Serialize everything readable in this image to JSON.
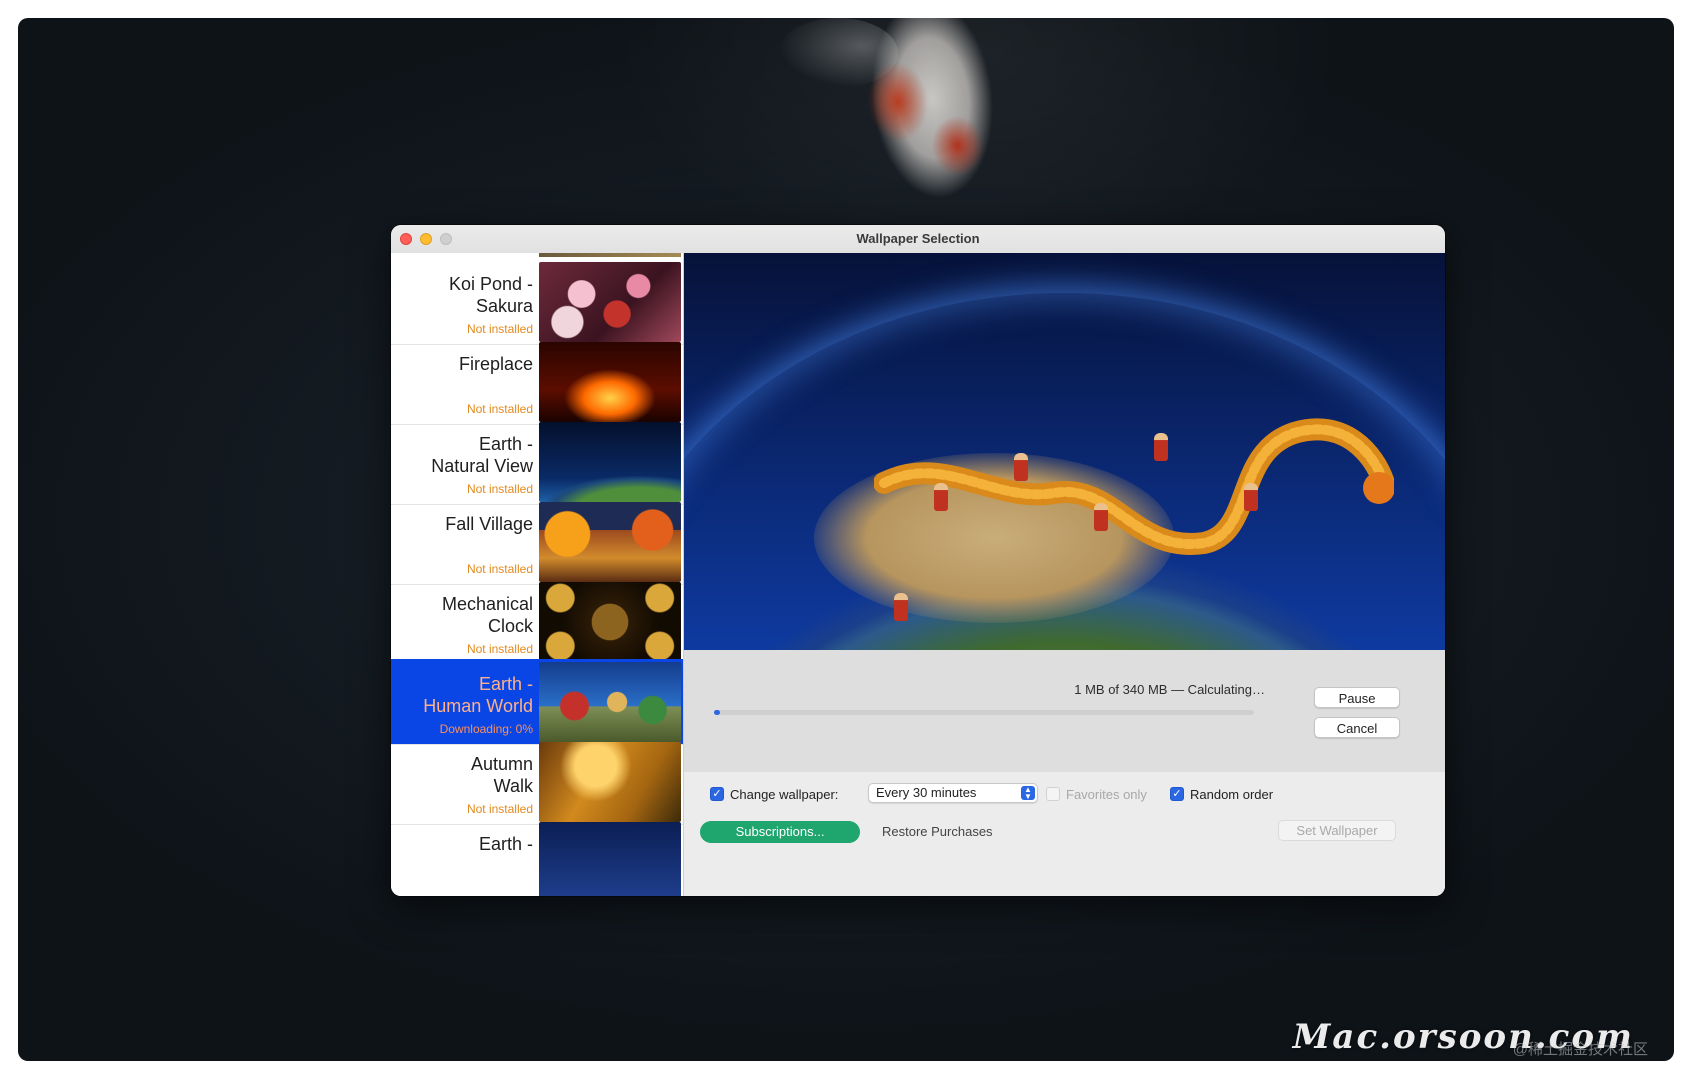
{
  "window": {
    "title": "Wallpaper Selection"
  },
  "wallpapers": [
    {
      "name": "Koi Pond -\nSakura",
      "status": "Not installed",
      "thumb": "koi-sakura"
    },
    {
      "name": "Fireplace",
      "status": "Not installed",
      "thumb": "fireplace"
    },
    {
      "name": "Earth -\nNatural View",
      "status": "Not installed",
      "thumb": "earth-natural"
    },
    {
      "name": "Fall Village",
      "status": "Not installed",
      "thumb": "fall-village"
    },
    {
      "name": "Mechanical\nClock",
      "status": "Not installed",
      "thumb": "mechanical-clock"
    },
    {
      "name": "Earth -\nHuman World",
      "status": "Downloading: 0%",
      "thumb": "earth-human",
      "selected": true
    },
    {
      "name": "Autumn\nWalk",
      "status": "Not installed",
      "thumb": "autumn-walk"
    },
    {
      "name": "Earth -",
      "status": "",
      "thumb": "earth-partial"
    }
  ],
  "download": {
    "progress_text": "1 MB of 340 MB — Calculating…",
    "progress_fraction": 0.003,
    "pause_label": "Pause",
    "cancel_label": "Cancel"
  },
  "options": {
    "change_wallpaper": {
      "label": "Change wallpaper:",
      "checked": true
    },
    "interval": {
      "selected": "Every 30 minutes"
    },
    "favorites_only": {
      "label": "Favorites only",
      "checked": false,
      "disabled": true
    },
    "random_order": {
      "label": "Random order",
      "checked": true
    }
  },
  "footer": {
    "subscriptions_label": "Subscriptions...",
    "restore_label": "Restore Purchases",
    "set_wallpaper_label": "Set Wallpaper"
  },
  "watermark": {
    "text": "Mac.orsoon.com",
    "sub": "@稀土掘金技术社区"
  },
  "colors": {
    "selection": "#0a46e6",
    "status_orange": "#e08a1c",
    "accent_blue": "#2b67e3",
    "subscriptions_green": "#1fa56e"
  }
}
